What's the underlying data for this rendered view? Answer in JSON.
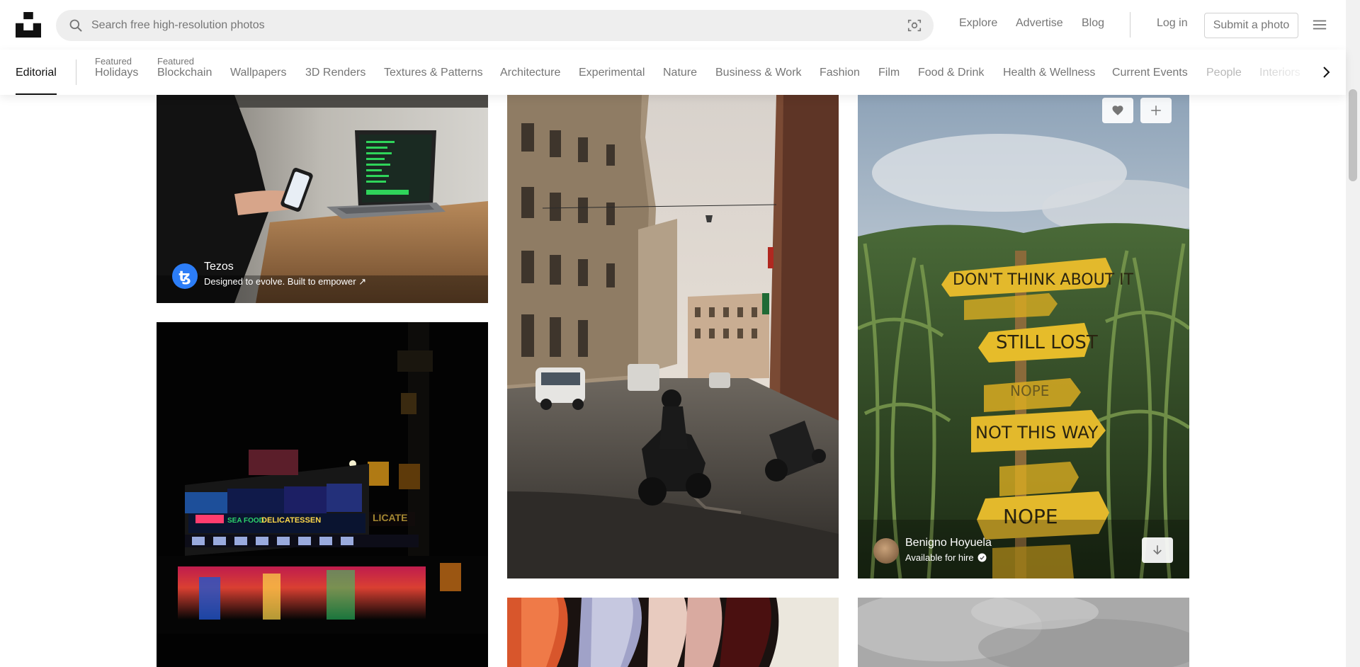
{
  "header": {
    "search_placeholder": "Search free high-resolution photos",
    "nav": {
      "explore": "Explore",
      "advertise": "Advertise",
      "blog": "Blog",
      "login": "Log in",
      "submit": "Submit a photo"
    },
    "icons": {
      "logo": "unsplash-logo",
      "search": "search-icon",
      "visual_search": "visual-search-icon",
      "menu": "hamburger-menu-icon"
    }
  },
  "topics": {
    "tabs": [
      {
        "eyebrow": "",
        "label": "Editorial"
      },
      {
        "eyebrow": "Featured",
        "label": "Holidays"
      },
      {
        "eyebrow": "Featured",
        "label": "Blockchain"
      },
      {
        "eyebrow": "",
        "label": "Wallpapers"
      },
      {
        "eyebrow": "",
        "label": "3D Renders"
      },
      {
        "eyebrow": "",
        "label": "Textures & Patterns"
      },
      {
        "eyebrow": "",
        "label": "Architecture"
      },
      {
        "eyebrow": "",
        "label": "Experimental"
      },
      {
        "eyebrow": "",
        "label": "Nature"
      },
      {
        "eyebrow": "",
        "label": "Business & Work"
      },
      {
        "eyebrow": "",
        "label": "Fashion"
      },
      {
        "eyebrow": "",
        "label": "Film"
      },
      {
        "eyebrow": "",
        "label": "Food & Drink"
      },
      {
        "eyebrow": "",
        "label": "Health & Wellness"
      },
      {
        "eyebrow": "",
        "label": "Current Events"
      },
      {
        "eyebrow": "",
        "label": "People"
      },
      {
        "eyebrow": "",
        "label": "Interiors"
      }
    ],
    "active": "Editorial",
    "next_icon": "chevron-right-icon"
  },
  "photos": {
    "sponsored": {
      "name": "Tezos",
      "tagline": "Designed to evolve. Built to empower ↗",
      "avatar_glyph": "ꜩ",
      "avatar_color": "#2c7df7"
    },
    "cornfield": {
      "author": "Benigno Hoyuela",
      "status": "Available for hire",
      "sign_texts": [
        "DON'T THINK ABOUT IT",
        "STILL LOST",
        "NOPE",
        "NOT THIS WAY",
        "NOPE"
      ],
      "buttons": {
        "like": "heart-icon",
        "add": "plus-icon",
        "download": "arrow-down-icon",
        "verified": "check-badge-icon"
      }
    },
    "neon": {
      "signs": [
        "SEA FOOD",
        "DELICATESSEN",
        "LICATE"
      ]
    }
  },
  "colors": {
    "accent_text": "#111111",
    "muted_text": "#767676",
    "search_bg": "#eeeeee",
    "tezos_blue": "#2c7df7"
  }
}
